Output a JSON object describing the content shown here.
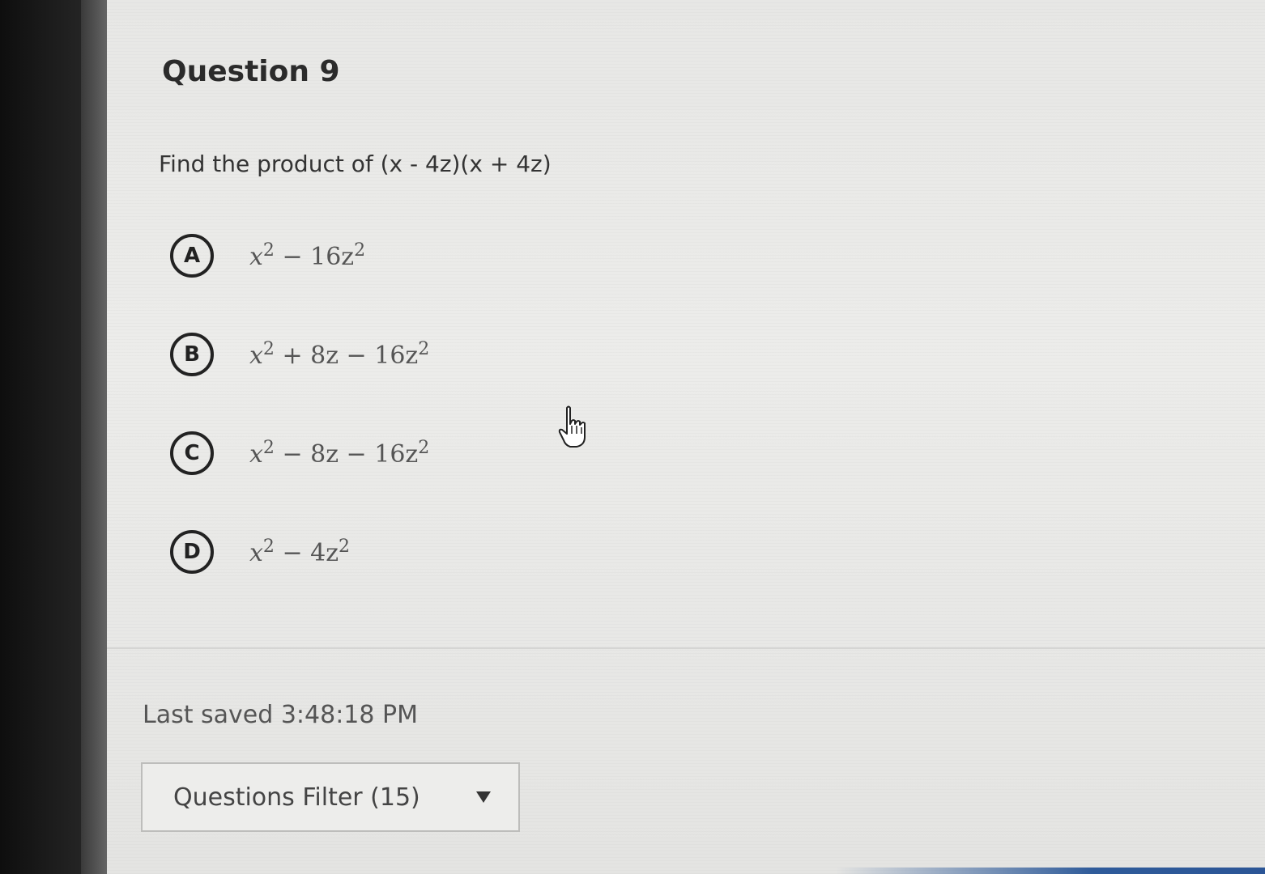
{
  "question": {
    "title": "Question 9",
    "prompt": "Find the product of (x - 4z)(x + 4z)"
  },
  "options": [
    {
      "letter": "A",
      "base": "x",
      "exp1": "2",
      "middle": " − 16z",
      "exp2": "2"
    },
    {
      "letter": "B",
      "base": "x",
      "exp1": "2",
      "middle": " + 8z − 16z",
      "exp2": "2"
    },
    {
      "letter": "C",
      "base": "x",
      "exp1": "2",
      "middle": " − 8z − 16z",
      "exp2": "2"
    },
    {
      "letter": "D",
      "base": "x",
      "exp1": "2",
      "middle": " − 4z",
      "exp2": "2"
    }
  ],
  "status": {
    "last_saved": "Last saved 3:48:18 PM"
  },
  "filter": {
    "label": "Questions Filter (15)"
  },
  "icons": {
    "cursor": "hand-pointer-icon",
    "dropdown": "triangle-down-icon"
  }
}
